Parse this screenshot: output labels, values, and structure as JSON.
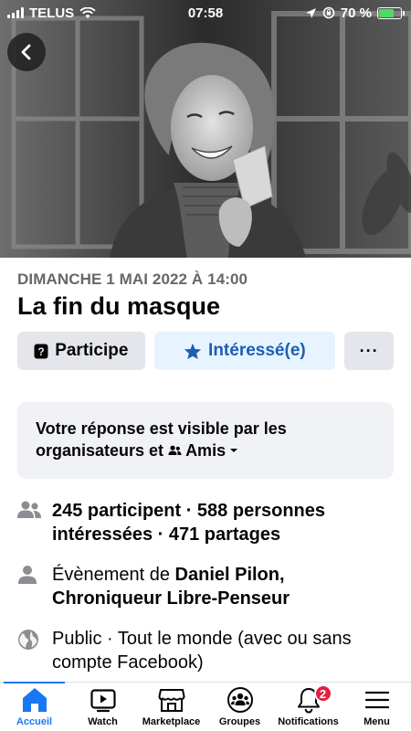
{
  "status_bar": {
    "carrier": "TELUS",
    "time": "07:58",
    "battery_percent": "70 %",
    "battery_level": 0.7
  },
  "event": {
    "date": "DIMANCHE 1 MAI 2022 À 14:00",
    "title": "La fin du masque"
  },
  "actions": {
    "going_label": "Participe",
    "interested_label": "Intéressé(e)",
    "more_label": "···"
  },
  "notice": {
    "text": "Votre réponse est visible par les organisateurs et",
    "audience": "Amis"
  },
  "details": {
    "participants": "245 participent · 588 personnes intéressées · 471 partages",
    "organizer_prefix": "Évènement de ",
    "organizer_name": "Daniel Pilon, Chroniqueur Libre-Penseur",
    "privacy": "Public · Tout le monde (avec ou sans compte Facebook)"
  },
  "tab_bar": {
    "tabs": [
      {
        "label": "Accueil",
        "icon": "home-icon"
      },
      {
        "label": "Watch",
        "icon": "watch-icon"
      },
      {
        "label": "Marketplace",
        "icon": "marketplace-icon"
      },
      {
        "label": "Groupes",
        "icon": "groups-icon"
      },
      {
        "label": "Notifications",
        "icon": "bell-icon"
      },
      {
        "label": "Menu",
        "icon": "menu-icon"
      }
    ],
    "notifications_badge": "2"
  },
  "colors": {
    "accent": "#1877f2",
    "badge": "#e41e3f"
  }
}
